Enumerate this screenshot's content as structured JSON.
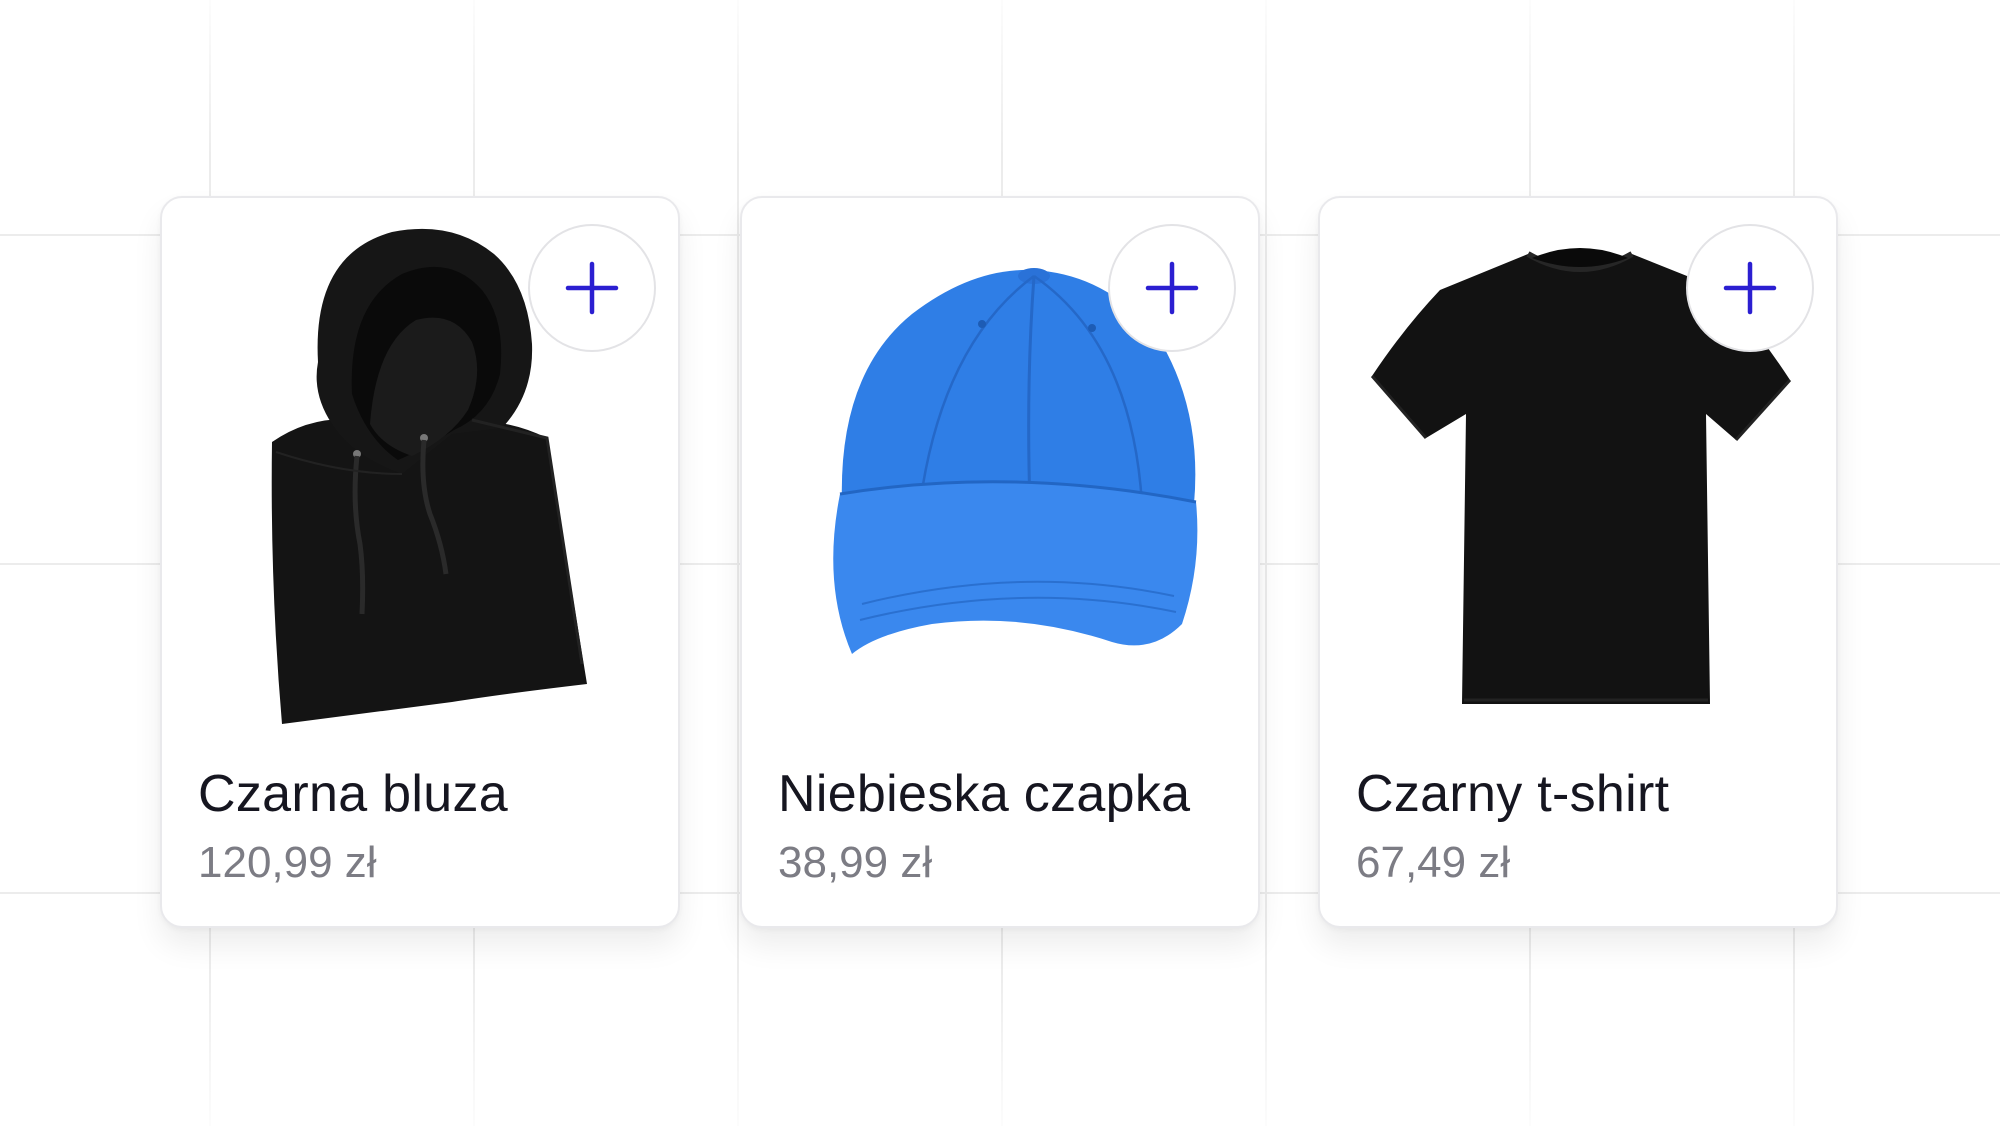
{
  "accent_color": "#2b1fd1",
  "products": [
    {
      "name": "Czarna bluza",
      "price": "120,99 zł",
      "image_icon": "black-hoodie-image",
      "color": "#141414"
    },
    {
      "name": "Niebieska czapka",
      "price": "38,99 zł",
      "image_icon": "blue-cap-image",
      "color": "#2f7ee6"
    },
    {
      "name": "Czarny t-shirt",
      "price": "67,49 zł",
      "image_icon": "black-tshirt-image",
      "color": "#121212"
    }
  ],
  "add_button_icon": "plus-icon"
}
